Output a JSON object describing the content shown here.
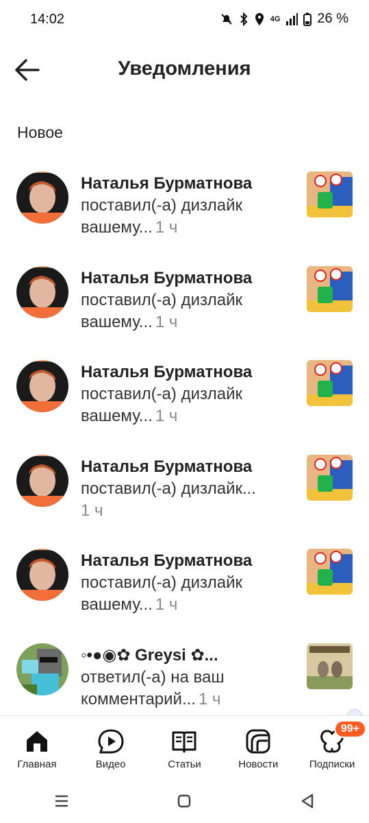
{
  "status_bar": {
    "time": "14:02",
    "network": "4G",
    "battery": "26 %"
  },
  "header": {
    "title": "Уведомления"
  },
  "section": {
    "title": "Новое"
  },
  "notifications": [
    {
      "name": "Наталья Бурматнова",
      "action": "поставил(-а) дизлайк вашему...",
      "time": "1 ч"
    },
    {
      "name": "Наталья Бурматнова",
      "action": "поставил(-а) дизлайк вашему...",
      "time": "1 ч"
    },
    {
      "name": "Наталья Бурматнова",
      "action": "поставил(-а) дизлайк вашему...",
      "time": "1 ч"
    },
    {
      "name": "Наталья Бурматнова",
      "action": "поставил(-а) дизлайк...",
      "time": "1 ч"
    },
    {
      "name": "Наталья Бурматнова",
      "action": "поставил(-а) дизлайк вашему...",
      "time": "1 ч"
    },
    {
      "name": "◦•●◉✿ Greysi ✿...",
      "action": "ответил(-а) на ваш комментарий...",
      "time": "1 ч"
    }
  ],
  "bottom_nav": {
    "items": [
      {
        "label": "Главная",
        "icon": "home-icon"
      },
      {
        "label": "Видео",
        "icon": "video-icon"
      },
      {
        "label": "Статьи",
        "icon": "articles-icon"
      },
      {
        "label": "Новости",
        "icon": "news-icon"
      },
      {
        "label": "Подписки",
        "icon": "subscriptions-icon"
      }
    ],
    "badge": "99+"
  },
  "colors": {
    "accent": "#ff5a1f",
    "text": "#222222",
    "muted": "#888888"
  }
}
